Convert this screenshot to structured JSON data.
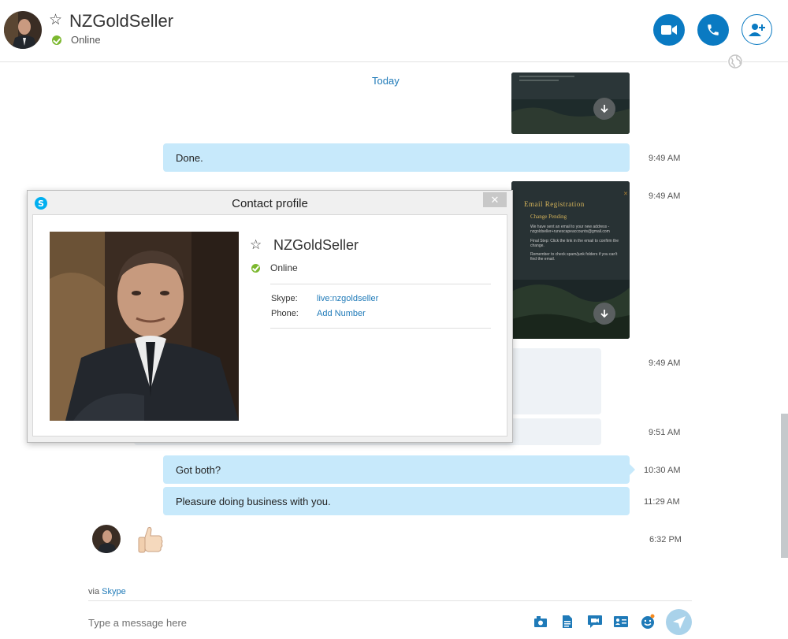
{
  "header": {
    "contact_name": "NZGoldSeller",
    "status": "Online"
  },
  "chat": {
    "date_divider": "Today",
    "messages": [
      {
        "text": "Done.",
        "time": "9:49 AM"
      },
      {
        "text": "",
        "time": "9:49 AM"
      },
      {
        "text": "",
        "time": "9:49 AM"
      },
      {
        "text": "",
        "time": "9:51 AM"
      },
      {
        "text": "Got both?",
        "time": "10:30 AM"
      },
      {
        "text": "Pleasure doing business with you.",
        "time": "11:29 AM"
      },
      {
        "text": "",
        "time": "6:32 PM"
      }
    ],
    "image_card": {
      "title": "Email Registration",
      "subtitle": "Change Pending",
      "body1": "We have sent an email to your new address - nzgoldseller+runescapeaccounts@gmail.com",
      "body2": "Final Step: Click the link in the email to confirm the change.",
      "body3": "Remember to check spam/junk folders if you can't find the email."
    }
  },
  "footer": {
    "via_prefix": "via",
    "via_link": "Skype",
    "input_placeholder": "Type a message here"
  },
  "profile_dialog": {
    "title": "Contact profile",
    "close_label": "✕",
    "name": "NZGoldSeller",
    "status": "Online",
    "skype_label": "Skype:",
    "skype_value": "live:nzgoldseller",
    "phone_label": "Phone:",
    "phone_value": "Add Number"
  },
  "colors": {
    "accent": "#0a7ac2",
    "outgoing_bubble": "#c7e9fb",
    "online": "#7cb82f",
    "link": "#1f7ab8"
  },
  "icons": {
    "favorite": "star-outline-icon",
    "video_call": "video-camera-icon",
    "voice_call": "phone-icon",
    "add_people": "add-person-icon",
    "download": "download-arrow-icon",
    "send": "send-plane-icon"
  }
}
